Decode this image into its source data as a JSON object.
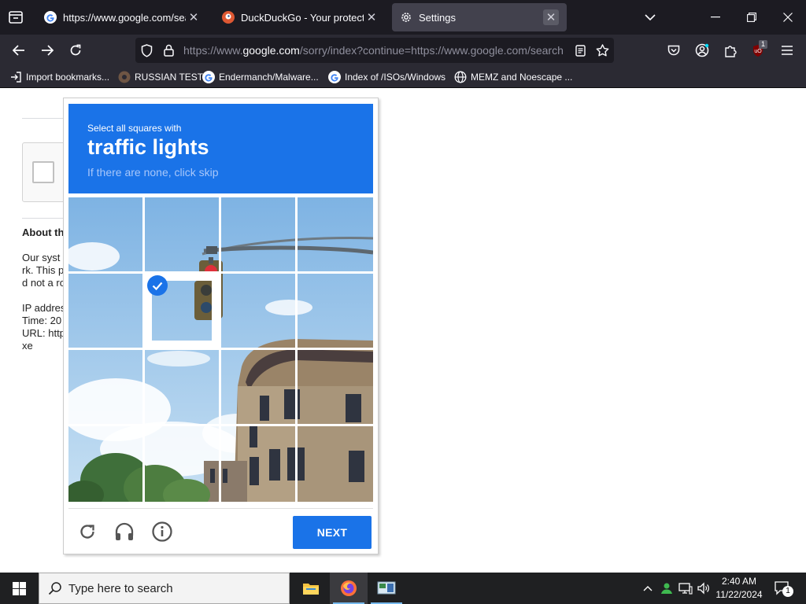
{
  "browser": {
    "tabs": [
      {
        "title": "https://www.google.com/search",
        "favicon": "google-g-icon",
        "active": false
      },
      {
        "title": "DuckDuckGo - Your protection, our priority",
        "favicon": "duckduckgo-icon",
        "active": false
      },
      {
        "title": "Settings",
        "favicon": "gear-icon",
        "active": true
      }
    ],
    "url": {
      "prefix": "https://www.",
      "domain": "google.com",
      "rest": "/sorry/index?continue=https://www.google.com/search"
    },
    "extension_badge": "1",
    "bookmarks": [
      {
        "label": "Import bookmarks...",
        "icon": "import-icon"
      },
      {
        "label": "RUSSIAN TEST",
        "icon": "github-icon"
      },
      {
        "label": "Endermanch/Malware...",
        "icon": "google-g-icon"
      },
      {
        "label": "Index of /ISOs/Windows",
        "icon": "google-g-icon"
      },
      {
        "label": "MEMZ and Noescape ...",
        "icon": "globe-icon"
      }
    ]
  },
  "page": {
    "heading": "About th",
    "para_lines": [
      "Our syst",
      "rk. This p",
      "d not a ro"
    ],
    "info_lines": [
      "IP addres",
      "Time: 20",
      "URL: http",
      "xe"
    ]
  },
  "captcha": {
    "instruction": "Select all squares with",
    "target": "traffic lights",
    "hint": "If there are none, click skip",
    "grid_size": 4,
    "selected_tiles": [
      5
    ],
    "next_label": "NEXT",
    "accent_color": "#1a73e8"
  },
  "taskbar": {
    "search_placeholder": "Type here to search",
    "time": "2:40 AM",
    "date": "11/22/2024",
    "notification_count": "1"
  }
}
